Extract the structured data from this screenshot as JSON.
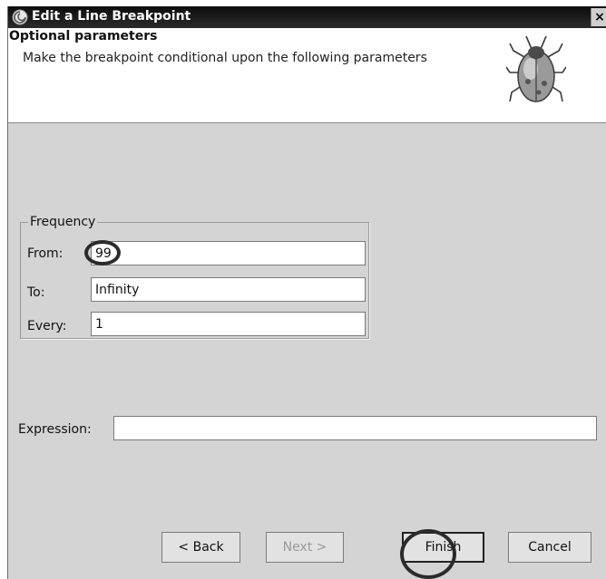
{
  "window": {
    "title": "Edit a Line Breakpoint",
    "close_glyph": "×"
  },
  "header": {
    "title": "Optional parameters",
    "description": "Make the breakpoint conditional upon the following parameters",
    "icon": "bug-icon"
  },
  "frequency": {
    "group_label": "Frequency",
    "from_label": "From:",
    "from_value": "99",
    "to_label": "To:",
    "to_value": "Infinity",
    "every_label": "Every:",
    "every_value": "1"
  },
  "expression": {
    "label": "Expression:",
    "value": ""
  },
  "buttons": {
    "back": "< Back",
    "next": "Next >",
    "finish": "Finish",
    "cancel": "Cancel"
  }
}
